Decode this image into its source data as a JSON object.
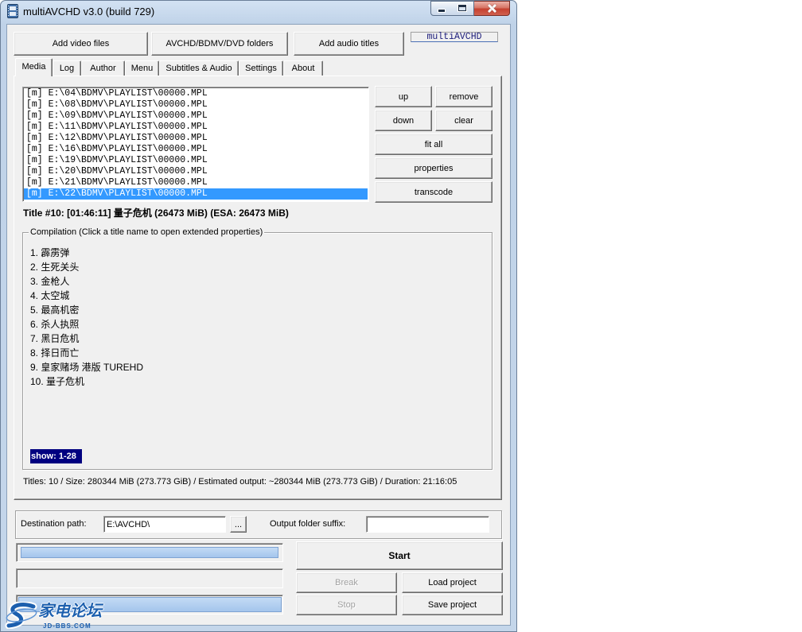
{
  "window": {
    "title": "multiAVCHD v3.0 (build 729)"
  },
  "icons": {
    "app": "film-icon",
    "minimize": "minimize-icon",
    "maximize": "maximize-icon",
    "close": "close-icon",
    "watermark_logo": "swirl-logo-icon"
  },
  "toolbar": {
    "add_video_label": "Add video files",
    "add_folders_label": "AVCHD/BDMV/DVD folders",
    "add_audio_label": "Add audio titles",
    "brand_label": "multiAVCHD"
  },
  "tabs": [
    {
      "label": "Media",
      "selected": true
    },
    {
      "label": "Log",
      "selected": false
    },
    {
      "label": "Author",
      "selected": false
    },
    {
      "label": "Menu",
      "selected": false
    },
    {
      "label": "Subtitles & Audio",
      "selected": false
    },
    {
      "label": "Settings",
      "selected": false
    },
    {
      "label": "About",
      "selected": false
    }
  ],
  "media": {
    "playlist": [
      "[m] E:\\04\\BDMV\\PLAYLIST\\00000.MPL",
      "[m] E:\\08\\BDMV\\PLAYLIST\\00000.MPL",
      "[m] E:\\09\\BDMV\\PLAYLIST\\00000.MPL",
      "[m] E:\\11\\BDMV\\PLAYLIST\\00000.MPL",
      "[m] E:\\12\\BDMV\\PLAYLIST\\00000.MPL",
      "[m] E:\\16\\BDMV\\PLAYLIST\\00000.MPL",
      "[m] E:\\19\\BDMV\\PLAYLIST\\00000.MPL",
      "[m] E:\\20\\BDMV\\PLAYLIST\\00000.MPL",
      "[m] E:\\21\\BDMV\\PLAYLIST\\00000.MPL",
      "[m] E:\\22\\BDMV\\PLAYLIST\\00000.MPL"
    ],
    "selected_index": 9,
    "buttons": {
      "up": "up",
      "remove": "remove",
      "down": "down",
      "clear": "clear",
      "fit_all": "fit all",
      "properties": "properties",
      "transcode": "transcode"
    },
    "title_info": "Title #10: [01:46:11] 量子危机 (26473 MiB) (ESA: 26473 MiB)",
    "compilation": {
      "legend": "Compilation (Click a title name to open extended properties)",
      "titles": [
        "1. 霹雳弹",
        "2. 生死关头",
        "3. 金枪人",
        "4. 太空城",
        "5. 最高机密",
        "6. 杀人执照",
        "7. 黑日危机",
        "8. 择日而亡",
        "9. 皇家赌场 港版 TUREHD",
        "10. 量子危机"
      ],
      "show_label": "show: 1-28"
    },
    "status": "Titles: 10 / Size: 280344 MiB (273.773 GiB) / Estimated output: ~280344 MiB (273.773 GiB) / Duration: 21:16:05"
  },
  "output": {
    "destination_label": "Destination path:",
    "destination_value": "E:\\AVCHD\\",
    "browse_label": "...",
    "suffix_label": "Output folder suffix:",
    "suffix_value": ""
  },
  "progress": [
    {
      "value": 1.0
    },
    {
      "value": 0
    },
    {
      "value": 1.0
    }
  ],
  "actions": {
    "start_label": "Start",
    "break_label": "Break",
    "load_label": "Load project",
    "stop_label": "Stop",
    "save_label": "Save project",
    "break_enabled": false,
    "stop_enabled": false
  },
  "watermark": {
    "title": "家电论坛",
    "subtitle": "JD-BBS.COM"
  },
  "colors": {
    "selection": "#3399ff",
    "show_badge": "#000080",
    "progress_fill_top": "#c3dbf5",
    "progress_fill_bottom": "#a4c5ec",
    "progress_fill_border": "#7ea3d3",
    "brand_text": "#1b1b7a",
    "watermark": "#1c5fae"
  }
}
